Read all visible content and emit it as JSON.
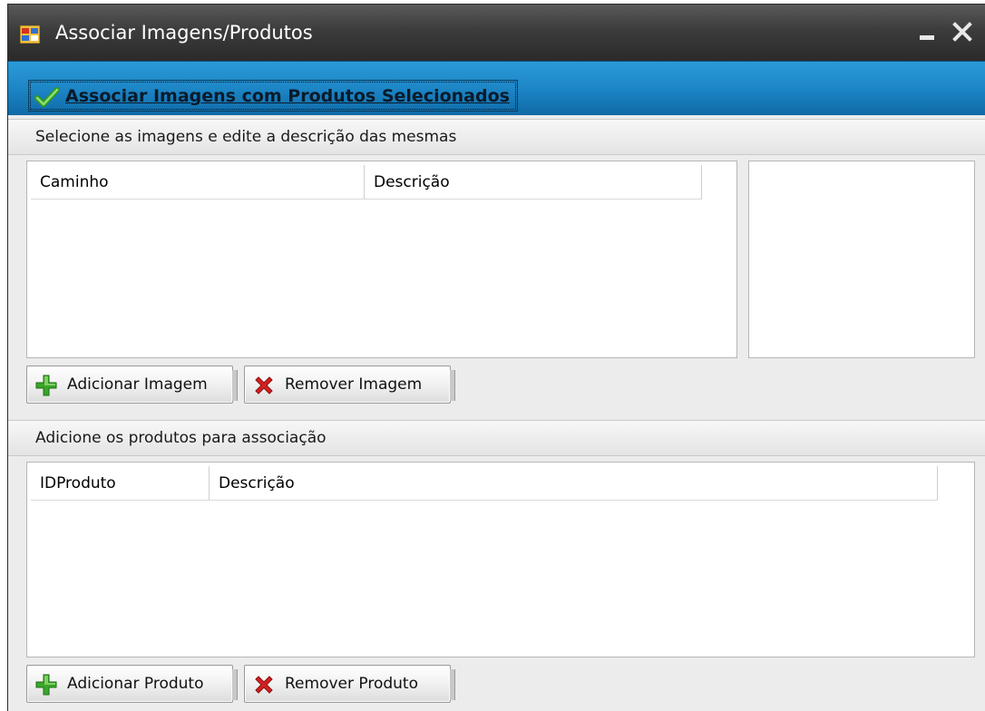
{
  "window": {
    "title": "Associar Imagens/Produtos"
  },
  "toolbar": {
    "associate_label": "Associar Imagens com Produtos Selecionados"
  },
  "images_section": {
    "header": "Selecione as imagens e edite a descrição das mesmas",
    "columns": [
      "Caminho",
      "Descrição"
    ],
    "add_label": "Adicionar Imagem",
    "remove_label": "Remover Imagem"
  },
  "products_section": {
    "header": "Adicione os produtos para associação",
    "columns": [
      "IDProduto",
      "Descrição"
    ],
    "add_label": "Adicionar Produto",
    "remove_label": "Remover Produto"
  },
  "colors": {
    "toolbar_blue": "#1d86c6",
    "titlebar_dark": "#3c3c3c",
    "add_green": "#3aa62a",
    "remove_red": "#d42020"
  },
  "icons": {
    "title": "form-icon",
    "associate": "checkmark-icon",
    "add": "plus-icon",
    "remove": "x-icon"
  }
}
